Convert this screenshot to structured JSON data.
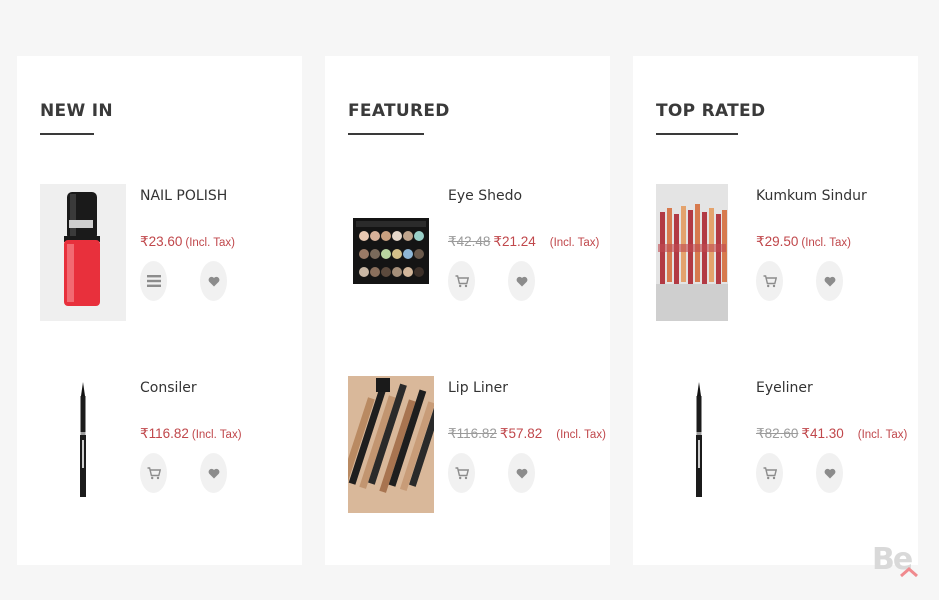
{
  "sections": [
    {
      "title": "NEW IN",
      "products": [
        {
          "name": "NAIL POLISH",
          "old_price": "",
          "price": "₹23.60",
          "tax": "(Incl. Tax)",
          "first_action_icon": "list-icon",
          "image": "nail-polish-image"
        },
        {
          "name": "Consiler",
          "old_price": "",
          "price": "₹116.82",
          "tax": "(Incl. Tax)",
          "first_action_icon": "cart-icon",
          "image": "eyeliner-pen-image"
        }
      ]
    },
    {
      "title": "FEATURED",
      "products": [
        {
          "name": "Eye Shedo",
          "old_price": "₹42.48",
          "price": "₹21.24",
          "tax": "(Incl. Tax)",
          "first_action_icon": "cart-icon",
          "image": "eyeshadow-palette-image"
        },
        {
          "name": "Lip Liner",
          "old_price": "₹116.82",
          "price": "₹57.82",
          "tax": "(Incl. Tax)",
          "first_action_icon": "cart-icon",
          "image": "lip-liner-pencils-image"
        }
      ]
    },
    {
      "title": "TOP RATED",
      "products": [
        {
          "name": "Kumkum Sindur",
          "old_price": "",
          "price": "₹29.50",
          "tax": "(Incl. Tax)",
          "first_action_icon": "cart-icon",
          "image": "kumkum-sindur-image"
        },
        {
          "name": "Eyeliner",
          "old_price": "₹82.60",
          "price": "₹41.30",
          "tax": "(Incl. Tax)",
          "first_action_icon": "cart-icon",
          "image": "eyeliner-pen-image"
        }
      ]
    }
  ],
  "watermark": "Be",
  "colors": {
    "page_bg": "#f6f6f6",
    "panel_bg": "#ffffff",
    "price": "#c0474b",
    "old_price": "#9b9b9b",
    "action_bg": "#f1f1f1",
    "icon": "#8c8c8c"
  }
}
